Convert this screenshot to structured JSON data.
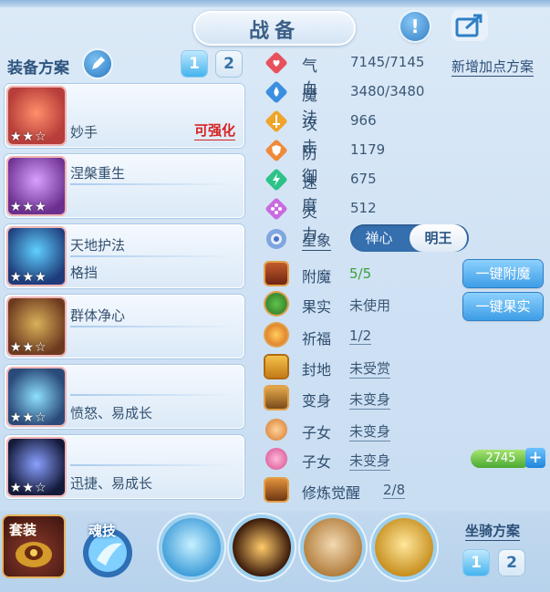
{
  "header": {
    "title": "战备"
  },
  "scheme": {
    "label": "装备方案",
    "buttons": [
      "1",
      "2"
    ]
  },
  "cards": [
    {
      "name": "妙手",
      "upgrade": "可强化",
      "stars": "★★☆"
    },
    {
      "name": "涅槃重生",
      "stars": "★★★"
    },
    {
      "name": "天地护法",
      "sub": "格挡",
      "stars": "★★★"
    },
    {
      "name": "群体净心",
      "stars": "★★☆"
    },
    {
      "name": "愤怒、易成长",
      "stars": "★★☆"
    },
    {
      "name": "迅捷、易成长",
      "stars": "★★☆"
    }
  ],
  "stats": [
    {
      "label": "气血",
      "value": "7145/7145",
      "icon": "heart-icon",
      "color": "#e8505b"
    },
    {
      "label": "魔法",
      "value": "3480/3480",
      "icon": "water-drop-icon",
      "color": "#3a8fe0"
    },
    {
      "label": "攻击",
      "value": "966",
      "icon": "sword-icon",
      "color": "#f0a42a"
    },
    {
      "label": "防御",
      "value": "1179",
      "icon": "shield-icon",
      "color": "#f08a3a"
    },
    {
      "label": "速度",
      "value": "675",
      "icon": "lightning-icon",
      "color": "#2ec28a"
    },
    {
      "label": "灵力",
      "value": "512",
      "icon": "sparkle-icon",
      "color": "#c86be0"
    }
  ],
  "new_plan": "新增加点方案",
  "star_sign": {
    "label": "星象",
    "options": [
      "禅心",
      "明王"
    ],
    "selected": "明王"
  },
  "lower": [
    {
      "label": "附魔",
      "value": "5/5",
      "icon": "enchant-icon"
    },
    {
      "label": "果实",
      "value": "未使用",
      "icon": "fruit-icon"
    },
    {
      "label": "祈福",
      "value": "1/2",
      "icon": "bless-icon"
    },
    {
      "label": "封地",
      "value": "未受赏",
      "icon": "fief-icon"
    },
    {
      "label": "变身",
      "value": "未变身",
      "icon": "transform-icon"
    },
    {
      "label": "子女",
      "value": "未变身",
      "icon": "child-icon"
    },
    {
      "label": "子女",
      "value": "未变身",
      "icon": "lotus-child-icon"
    },
    {
      "label": "修炼觉醒",
      "value": "2/8",
      "icon": "cultivation-icon"
    }
  ],
  "actions": {
    "enchant": "一键附魔",
    "fruit": "一键果实"
  },
  "currency": {
    "value": "2745",
    "plus": "+"
  },
  "bottom": {
    "set_label": "套装",
    "soul_label": "魂技",
    "mount_label": "坐骑方案",
    "mount_buttons": [
      "1",
      "2"
    ]
  },
  "colors": {
    "enchant_value": "#3aa03a",
    "upgrade": "#d62222"
  }
}
